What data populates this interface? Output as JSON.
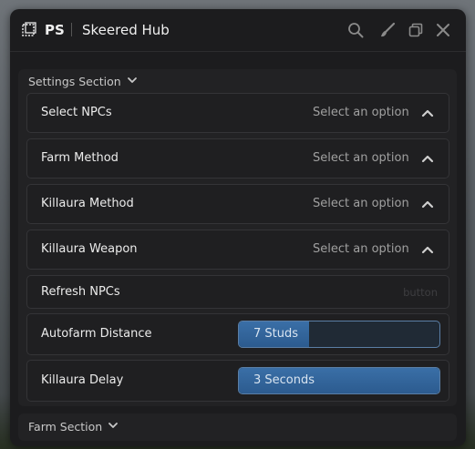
{
  "window": {
    "short_name": "PS",
    "title": "Skeered Hub"
  },
  "titlebar_icons": [
    "search-icon",
    "brush-icon",
    "window-stack-icon",
    "close-icon"
  ],
  "settings_section": {
    "label": "Settings Section",
    "dropdowns": [
      {
        "label": "Select NPCs",
        "value": "Select an option"
      },
      {
        "label": "Farm Method",
        "value": "Select an option"
      },
      {
        "label": "Killaura Method",
        "value": "Select an option"
      },
      {
        "label": "Killaura Weapon",
        "value": "Select an option"
      }
    ],
    "button": {
      "label": "Refresh NPCs",
      "hint": "button"
    },
    "sliders": [
      {
        "label": "Autofarm Distance",
        "value_text": "7 Studs",
        "level": 0.35
      },
      {
        "label": "Killaura Delay",
        "value_text": "3 Seconds",
        "level": 1.0
      }
    ]
  },
  "farm_section": {
    "label": "Farm Section"
  },
  "colors": {
    "window_bg": "#1c1c1e",
    "accent": "#2c5b8f",
    "accent_border": "#5a7ea5"
  }
}
